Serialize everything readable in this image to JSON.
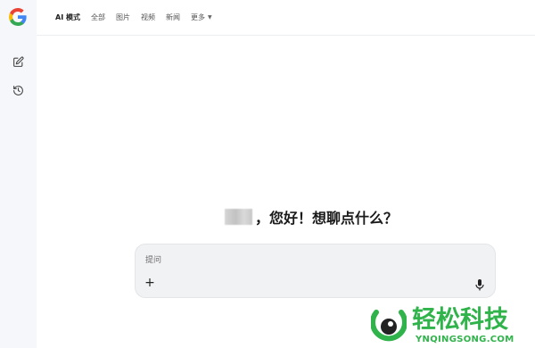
{
  "nav": {
    "items": [
      {
        "label": "AI 模式",
        "active": true
      },
      {
        "label": "全部",
        "active": false
      },
      {
        "label": "图片",
        "active": false
      },
      {
        "label": "视频",
        "active": false
      },
      {
        "label": "新闻",
        "active": false
      }
    ],
    "more_label": "更多"
  },
  "sidebar": {
    "logo_icon": "google-g-logo",
    "new_chat_icon": "edit-icon",
    "history_icon": "history-icon"
  },
  "greeting": {
    "text": "，您好！想聊点什么？"
  },
  "composer": {
    "placeholder": "提问",
    "add_label": "+",
    "mic_icon": "mic-icon"
  },
  "watermark": {
    "cn": "轻松科技",
    "en": "YNQINGSONG.COM"
  },
  "colors": {
    "sidebar_bg": "#f5f7fa",
    "input_bg": "#f1f2f4",
    "watermark_green": "#2fb34a"
  }
}
